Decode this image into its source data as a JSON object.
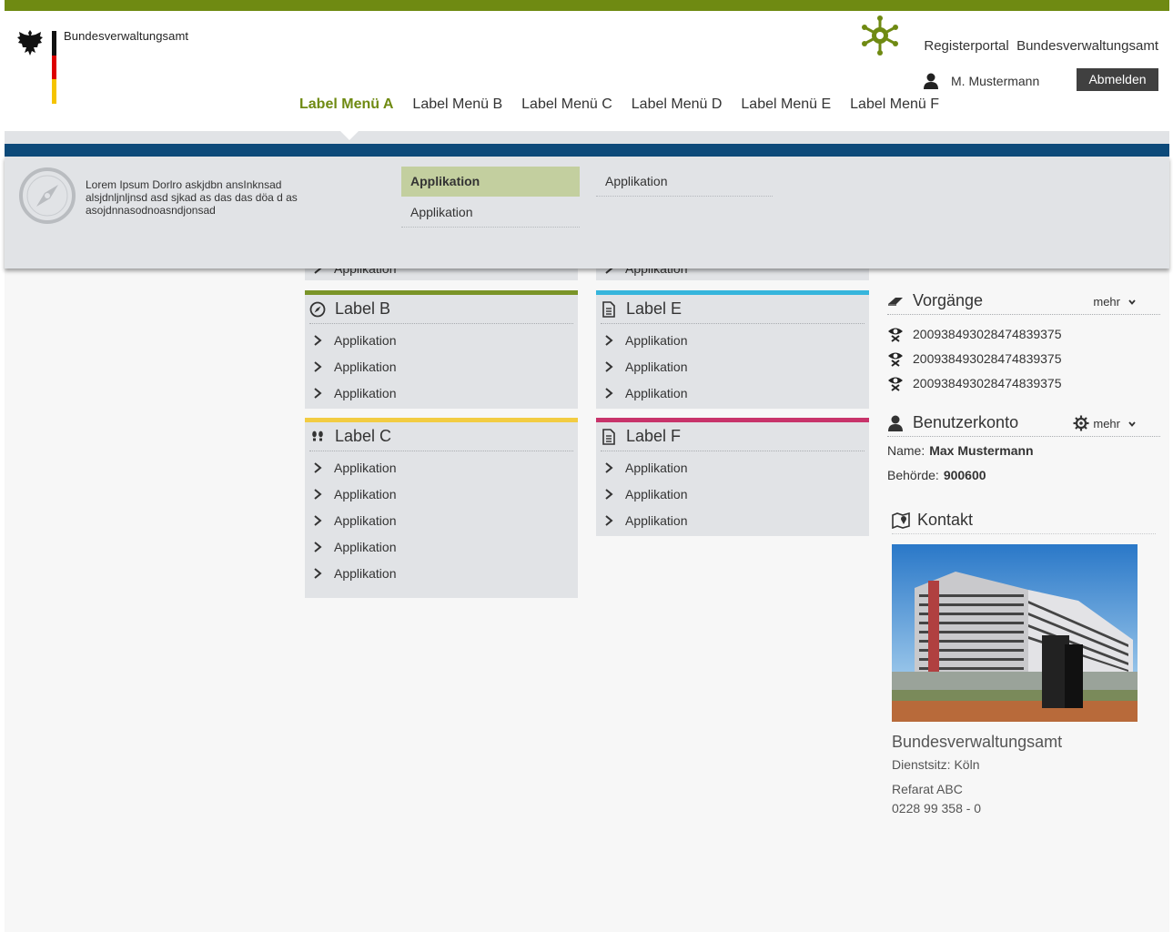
{
  "header": {
    "org_name": "Bundesverwaltungsamt",
    "portal_title": "Registerportal  Bundesverwaltungsamt",
    "user_name": "M. Mustermann",
    "logout_label": "Abmelden",
    "colors": {
      "brand_green": "#6f8a12",
      "nav_blue": "#0d4a7a"
    }
  },
  "nav": {
    "items": [
      {
        "label": "Label Menü A",
        "active": true
      },
      {
        "label": "Label Menü B"
      },
      {
        "label": "Label Menü C"
      },
      {
        "label": "Label Menü D"
      },
      {
        "label": "Label Menü E"
      },
      {
        "label": "Label Menü F"
      }
    ]
  },
  "dropdown": {
    "description": "Lorem Ipsum Dorlro askjdbn ansInknsad alsjdnljnljnsd asd sjkad as das das döa d as asojdnnasodnoasndjonsad",
    "col1": [
      "Applikation",
      "Applikation"
    ],
    "col2": [
      "Applikation"
    ]
  },
  "cards": {
    "partial_left": {
      "row": "Applikation"
    },
    "partial_right": {
      "row": "Applikation"
    },
    "b": {
      "title": "Label B",
      "color": "#7a9428",
      "rows": [
        "Applikation",
        "Applikation",
        "Applikation"
      ]
    },
    "e": {
      "title": "Label E",
      "color": "#36b5dc",
      "rows": [
        "Applikation",
        "Applikation",
        "Applikation"
      ]
    },
    "c": {
      "title": "Label C",
      "color": "#f2cc42",
      "rows": [
        "Applikation",
        "Applikation",
        "Applikation",
        "Applikation",
        "Applikation"
      ]
    },
    "f": {
      "title": "Label F",
      "color": "#c8336a",
      "rows": [
        "Applikation",
        "Applikation",
        "Applikation"
      ]
    }
  },
  "vorgaenge": {
    "title": "Vorgänge",
    "more": "mehr",
    "items": [
      "2009384930284748393‌75",
      "2009384930284748393‌75",
      "2009384930284748393‌75"
    ]
  },
  "konto": {
    "title": "Benutzerkonto",
    "more": "mehr",
    "name_label": "Name:",
    "name_value": "Max Mustermann",
    "behoerde_label": "Behörde:",
    "behoerde_value": "900600"
  },
  "kontakt": {
    "title": "Kontakt",
    "org": "Bundesverwaltungsamt",
    "sitz": "Dienstsitz: Köln",
    "referat": "Refarat ABC",
    "phone": "0228 99 358 - 0"
  }
}
